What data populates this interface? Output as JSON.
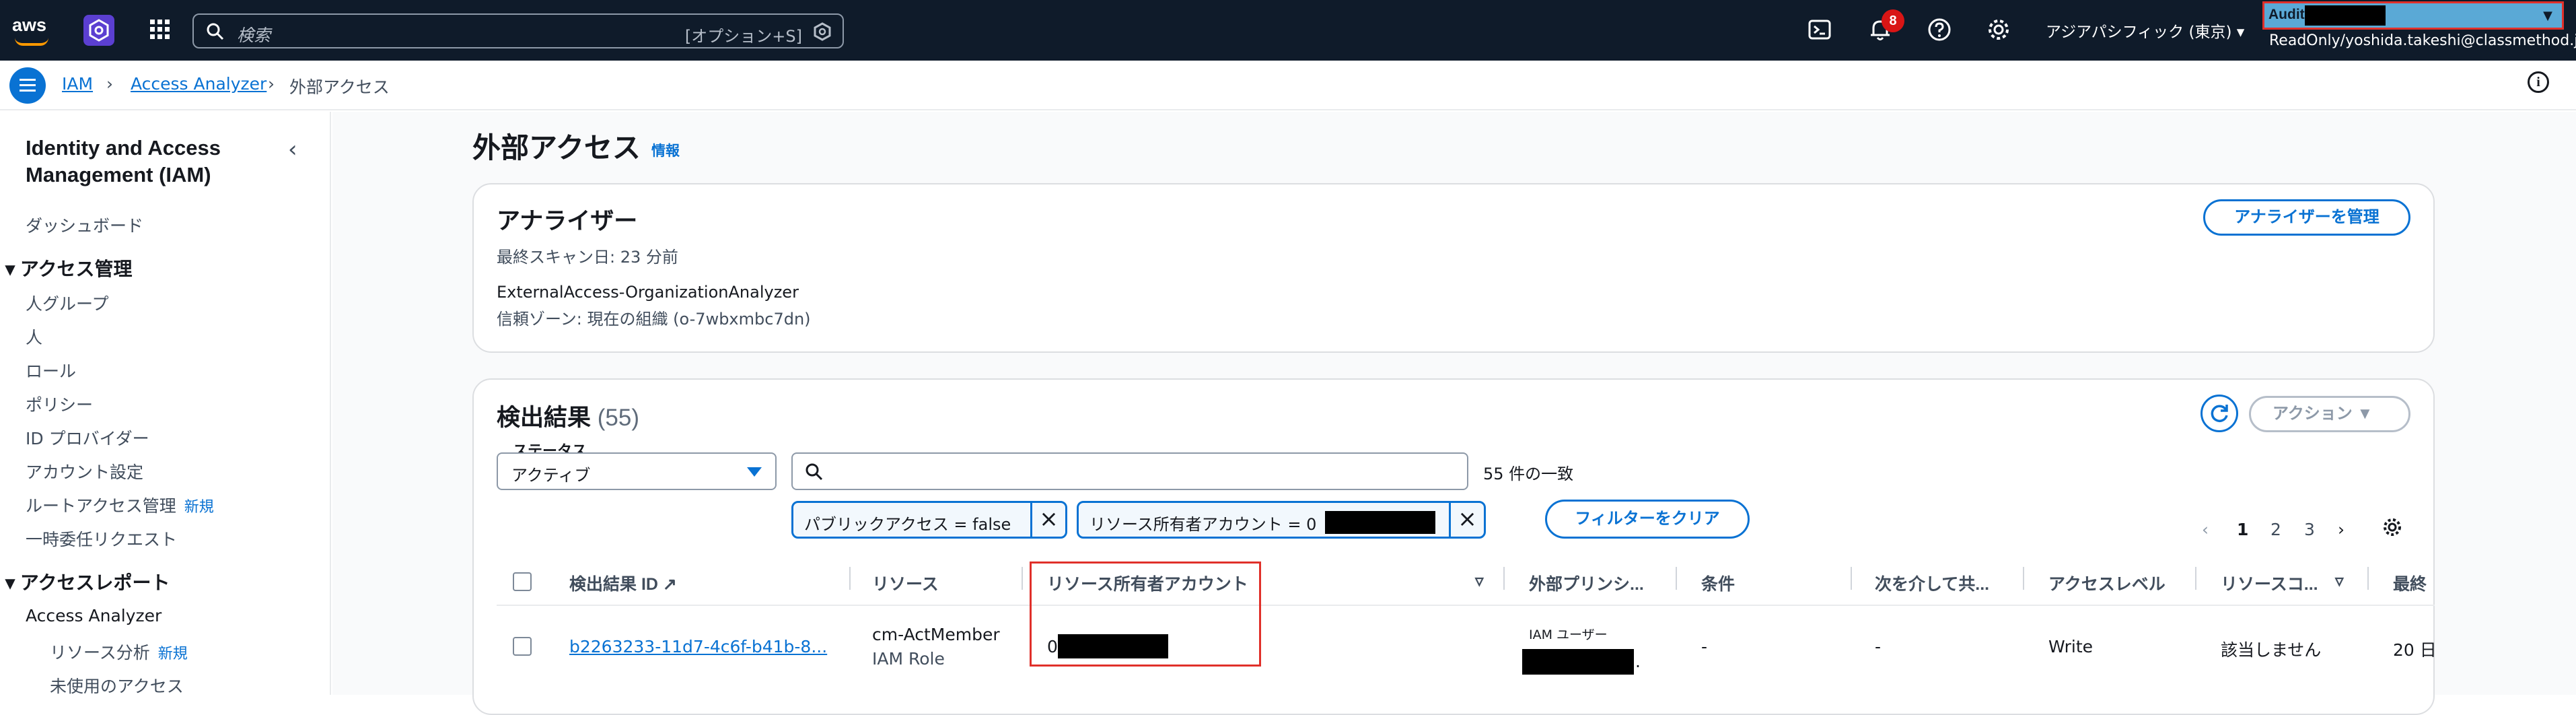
{
  "topbar": {
    "logo_text": "aws",
    "search_placeholder": "検索",
    "search_shortcut": "[オプション+S]",
    "notification_count": "8",
    "region": "アジアパシフィック (東京) ▾",
    "account_label": "Audit (5",
    "account_subtitle": "ReadOnly/yoshida.takeshi@classmethod.jp",
    "icons": [
      "cloudshell-icon",
      "bell-icon",
      "help-icon",
      "gear-icon"
    ]
  },
  "breadcrumb": {
    "items": [
      "IAM",
      "Access Analyzer",
      "外部アクセス"
    ]
  },
  "sidebar": {
    "title": "Identity and Access Management (IAM)",
    "dashboard": "ダッシュボード",
    "section_access_management": "アクセス管理",
    "access_items": [
      "人グループ",
      "人",
      "ロール",
      "ポリシー",
      "ID プロバイダー",
      "アカウント設定",
      "ルートアクセス管理",
      "一時委任リクエスト"
    ],
    "new_label": "新規",
    "section_access_reports": "アクセスレポート",
    "report_items": [
      "Access Analyzer",
      "リソース分析",
      "未使用のアクセス"
    ]
  },
  "page": {
    "title": "外部アクセス",
    "info_link": "情報"
  },
  "analyzer_card": {
    "title": "アナライザー",
    "last_scan": "最終スキャン日: 23 分前",
    "analyzer_name": "ExternalAccess-OrganizationAnalyzer",
    "zone_of_trust": "信頼ゾーン: 現在の組織 (o-7wbxmbc7dn)",
    "manage_button": "アナライザーを管理"
  },
  "findings": {
    "title": "検出結果",
    "count": "(55)",
    "actions_button": "アクション ▼",
    "status_label": "ステータス",
    "status_value": "アクティブ",
    "match_count": "55 件の一致",
    "filters": [
      "パブリックアクセス = false",
      "リソース所有者アカウント = 0"
    ],
    "clear_filters": "フィルターをクリア",
    "pagination": [
      "1",
      "2",
      "3"
    ],
    "columns": [
      "検出結果 ID",
      "リソース",
      "リソース所有者アカウント",
      "外部プリンシ...",
      "条件",
      "次を介して共...",
      "アクセスレベル",
      "リソースコ...",
      "最終"
    ],
    "row": {
      "id": "b2263233-11d7-4c6f-b41b-8...",
      "resource_name": "cm-ActMember",
      "resource_type": "IAM Role",
      "owner_account": "0",
      "principal_type": "IAM ユーザー",
      "principal_tail": ".",
      "condition": "-",
      "shared_via": "-",
      "access_level": "Write",
      "resource_control": "該当しません",
      "last_updated": "20 日"
    }
  }
}
